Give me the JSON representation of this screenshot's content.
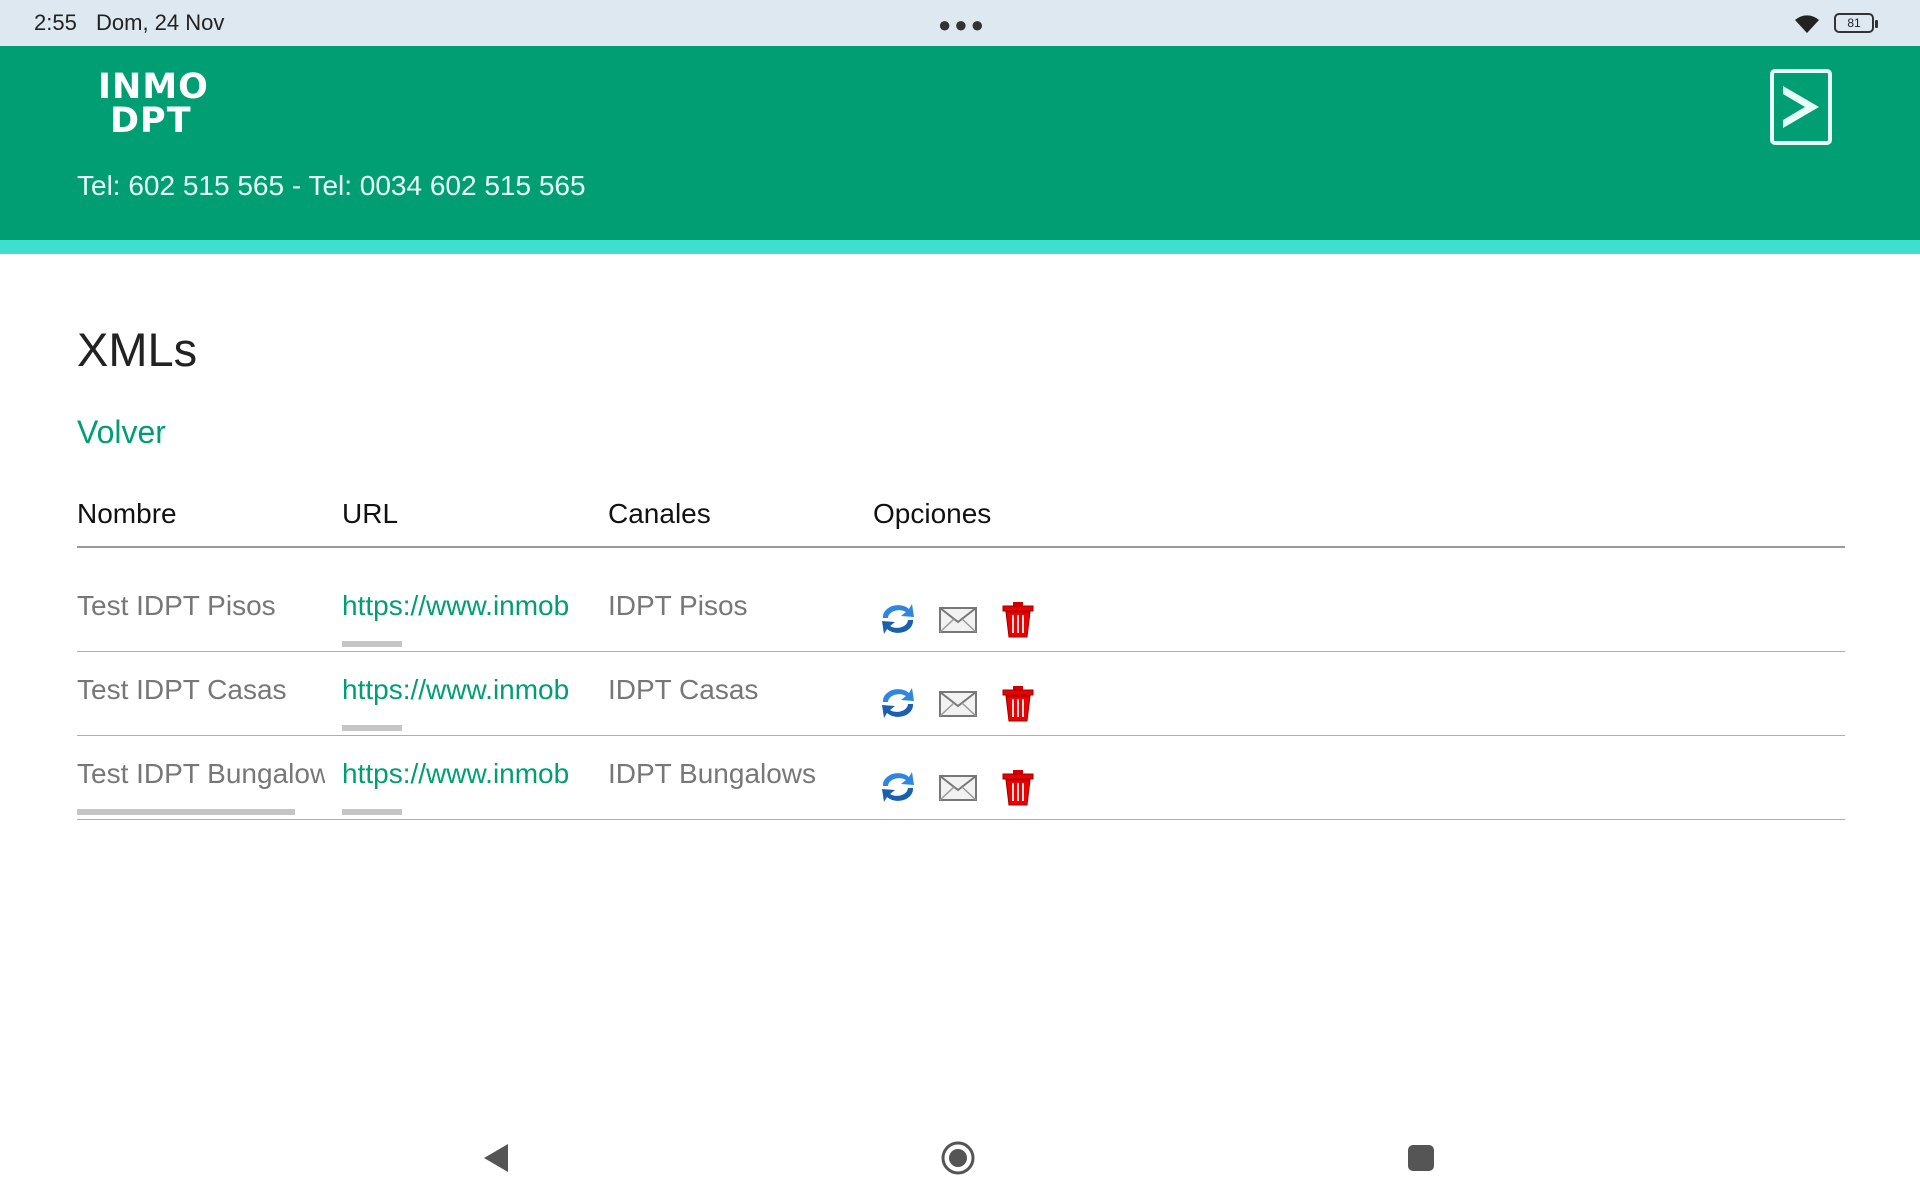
{
  "status_bar": {
    "time": "2:55",
    "date": "Dom, 24 Nov",
    "battery": "81"
  },
  "header": {
    "logo_line1": "INMO",
    "logo_line2": "DPT",
    "phones": "Tel: 602 515 565 - Tel: 0034 602 515 565",
    "bg_color": "#019e74",
    "stripe_color": "#3fdfcf"
  },
  "page": {
    "title": "XMLs",
    "back_label": "Volver"
  },
  "table": {
    "columns": [
      "Nombre",
      "URL",
      "Canales",
      "Opciones"
    ],
    "rows": [
      {
        "name": "Test IDPT Pisos",
        "url": "https://www.inmob",
        "channel": "IDPT Pisos"
      },
      {
        "name": "Test IDPT Casas",
        "url": "https://www.inmob",
        "channel": "IDPT Casas"
      },
      {
        "name": "Test IDPT Bungalow",
        "url": "https://www.inmob",
        "channel": "IDPT Bungalows"
      }
    ],
    "option_icons": [
      "refresh-icon",
      "mail-icon",
      "trash-icon"
    ]
  },
  "nav_bar": {
    "icons": [
      "back-icon",
      "home-icon",
      "recent-apps-icon"
    ]
  }
}
